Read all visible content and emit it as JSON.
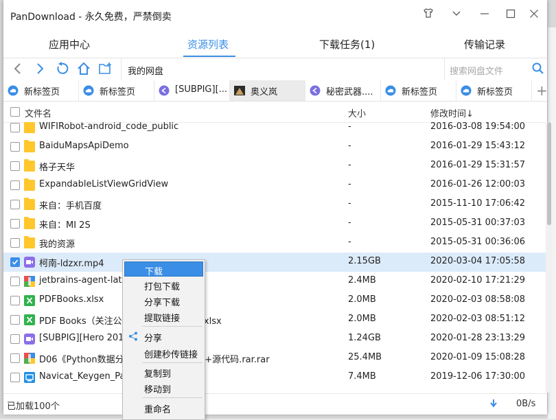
{
  "window": {
    "title": "PanDownload - 永久免费，严禁倒卖"
  },
  "nav_tabs": [
    {
      "label": "应用中心",
      "active": false
    },
    {
      "label": "资源列表",
      "active": true
    },
    {
      "label": "下载任务(1)",
      "active": false
    },
    {
      "label": "传输记录",
      "active": false
    }
  ],
  "toolbar": {
    "path": "我的网盘",
    "search_placeholder": "搜索网盘文件"
  },
  "browser_tabs": [
    {
      "label": "新标签页",
      "icon": "cloud-icon",
      "active": false
    },
    {
      "label": "新标签页",
      "icon": "cloud-icon",
      "active": false
    },
    {
      "label": "[SUBPIG][...",
      "icon": "link-icon",
      "active": false
    },
    {
      "label": "奥义岚",
      "icon": "thumbnail-icon",
      "active": true
    },
    {
      "label": "秘密武器....",
      "icon": "link-icon",
      "active": false
    },
    {
      "label": "新标签页",
      "icon": "cloud-icon",
      "active": false
    },
    {
      "label": "新标签页",
      "icon": "cloud-icon",
      "active": false
    }
  ],
  "columns": {
    "name": "文件名",
    "size": "大小",
    "date": "修改时间↓"
  },
  "files": [
    {
      "name": "WIFIRobot-android_code_public",
      "size": "-",
      "date": "2016-03-08 19:54:00",
      "icon": "folder-icon",
      "checked": false
    },
    {
      "name": "BaiduMapsApiDemo",
      "size": "-",
      "date": "2016-01-29 15:43:12",
      "icon": "folder-icon",
      "checked": false
    },
    {
      "name": "格子天华",
      "size": "-",
      "date": "2016-01-29 15:31:57",
      "icon": "folder-icon",
      "checked": false
    },
    {
      "name": "ExpandableListViewGridView",
      "size": "-",
      "date": "2016-01-26 12:00:03",
      "icon": "folder-icon",
      "checked": false
    },
    {
      "name": "来自：手机百度",
      "size": "-",
      "date": "2015-11-10 17:06:42",
      "icon": "folder-icon",
      "checked": false
    },
    {
      "name": "来自：MI 2S",
      "size": "-",
      "date": "2015-05-31 00:37:03",
      "icon": "folder-icon",
      "checked": false
    },
    {
      "name": "我的资源",
      "size": "-",
      "date": "2015-05-31 00:36:06",
      "icon": "folder-icon",
      "checked": false
    },
    {
      "name": "柯南-ldzxr.mp4",
      "size": "2.15GB",
      "date": "2020-03-04 17:05:58",
      "icon": "video-icon",
      "checked": true
    },
    {
      "name": "jetbrains-agent-late",
      "size": "2.4MB",
      "date": "2020-02-10 17:21:29",
      "icon": "archive-icon",
      "checked": false
    },
    {
      "name": "PDFBooks.xlsx",
      "size": "2.0MB",
      "date": "2020-02-03 08:58:08",
      "icon": "excel-icon",
      "checked": false
    },
    {
      "name": "PDF Books（关注公众号                 复1004获取）.xlsx",
      "size": "2.0MB",
      "date": "2020-02-03 08:51:12",
      "icon": "excel-icon",
      "checked": false
    },
    {
      "name": "[SUBPIG][Hero 2015",
      "size": "1.24GB",
      "date": "2020-01-28 23:13:29",
      "icon": "video-icon",
      "checked": false
    },
    {
      "name": "D06《Python数据分                          PDF+高清英文PDF+源代码.rar.rar",
      "size": "25.4MB",
      "date": "2020-01-09 15:08:28",
      "icon": "archive-icon",
      "checked": false
    },
    {
      "name": "Navicat_Keygen_Pat                         xe",
      "size": "7.4MB",
      "date": "2019-12-06 17:30:00",
      "icon": "exe-icon",
      "checked": false
    }
  ],
  "status": {
    "loaded": "已加载100个",
    "speed": "0B/s"
  },
  "context_menu": [
    {
      "label": "下载",
      "highlight": true
    },
    {
      "label": "打包下载"
    },
    {
      "label": "分享下载"
    },
    {
      "label": "提取链接"
    },
    {
      "label": "分享"
    },
    {
      "label": "创建秒传链接"
    },
    {
      "label": "复制到"
    },
    {
      "label": "移动到"
    },
    {
      "label": "重命名"
    }
  ],
  "colors": {
    "accent": "#3a8ee6",
    "folder": "#ffc72c",
    "selected_row": "#dcebfa"
  }
}
